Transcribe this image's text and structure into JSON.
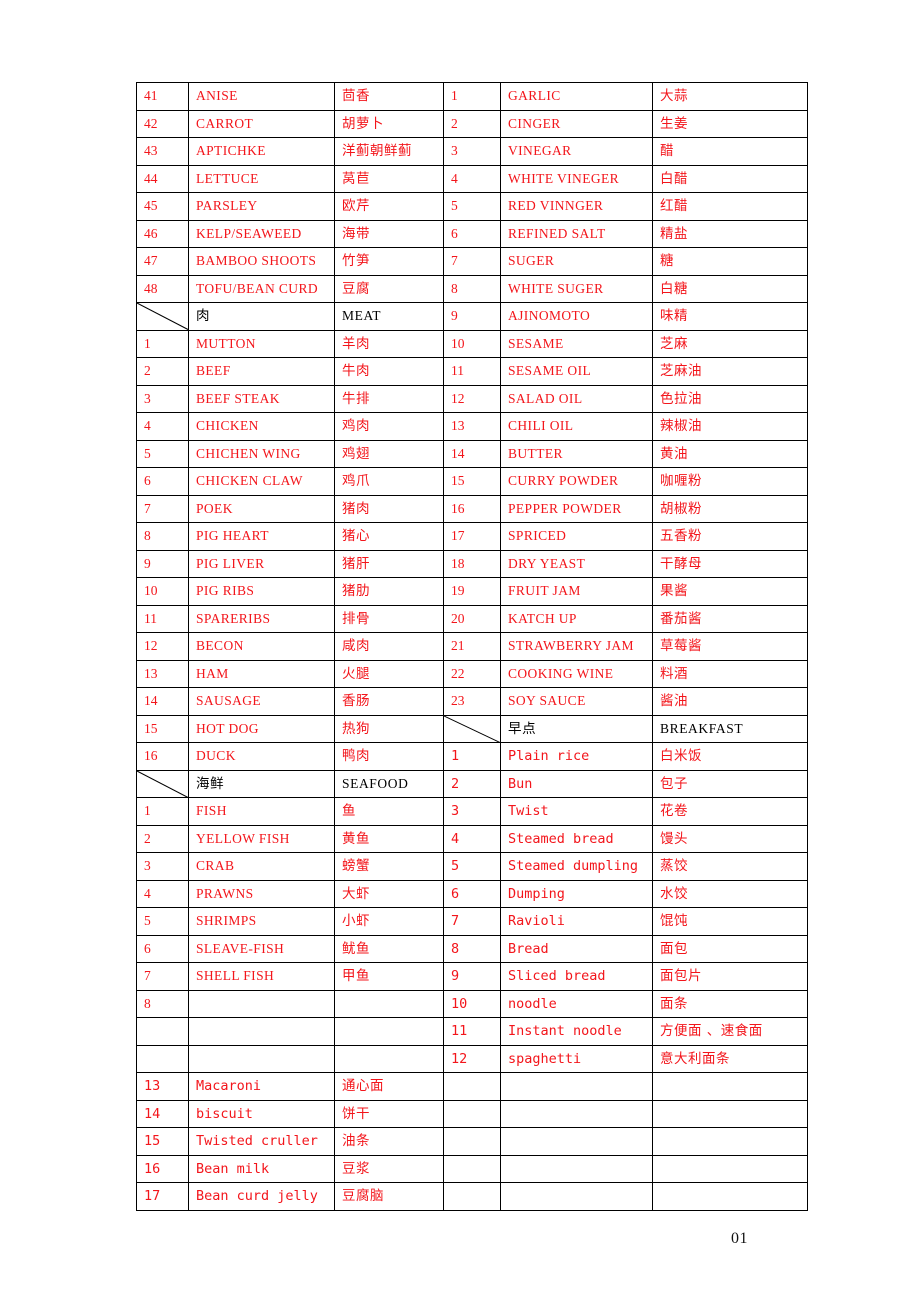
{
  "document": {
    "page_number": "01",
    "text_color": "#f3151b",
    "header_text_color": "#000000",
    "border_color": "#000000"
  },
  "table": {
    "columns": [
      "no_left",
      "english_left",
      "chinese_left",
      "no_right",
      "english_right",
      "chinese_right"
    ],
    "rows": [
      {
        "left": {
          "no": "41",
          "en": "ANISE",
          "zh": "茴香"
        },
        "right": {
          "no": "1",
          "en": "GARLIC",
          "zh": "大蒜"
        }
      },
      {
        "left": {
          "no": "42",
          "en": "CARROT",
          "zh": "胡萝卜"
        },
        "right": {
          "no": "2",
          "en": "CINGER",
          "zh": "生姜"
        }
      },
      {
        "left": {
          "no": "43",
          "en": "APTICHKE",
          "zh": "洋蓟朝鲜蓟"
        },
        "right": {
          "no": "3",
          "en": "VINEGAR",
          "zh": "醋"
        }
      },
      {
        "left": {
          "no": "44",
          "en": "LETTUCE",
          "zh": "莴苣"
        },
        "right": {
          "no": "4",
          "en": "WHITE VINEGER",
          "zh": "白醋"
        }
      },
      {
        "left": {
          "no": "45",
          "en": "PARSLEY",
          "zh": "欧芹"
        },
        "right": {
          "no": "5",
          "en": "RED VINNGER",
          "zh": "红醋"
        }
      },
      {
        "left": {
          "no": "46",
          "en": "KELP/SEAWEED",
          "zh": "海带"
        },
        "right": {
          "no": "6",
          "en": "REFINED SALT",
          "zh": "精盐"
        }
      },
      {
        "left": {
          "no": "47",
          "en": "BAMBOO SHOOTS",
          "zh": "竹笋"
        },
        "right": {
          "no": "7",
          "en": "SUGER",
          "zh": "糖"
        }
      },
      {
        "left": {
          "no": "48",
          "en": "TOFU/BEAN CURD",
          "zh": "豆腐"
        },
        "right": {
          "no": "8",
          "en": "WHITE SUGER",
          "zh": "白糖"
        }
      },
      {
        "left": {
          "no": "",
          "en": "肉",
          "zh": "MEAT",
          "style": "section"
        },
        "right": {
          "no": "9",
          "en": "AJINOMOTO",
          "zh": "味精"
        }
      },
      {
        "left": {
          "no": "1",
          "en": "MUTTON",
          "zh": "羊肉"
        },
        "right": {
          "no": "10",
          "en": "SESAME",
          "zh": "芝麻"
        }
      },
      {
        "left": {
          "no": "2",
          "en": "BEEF",
          "zh": "牛肉"
        },
        "right": {
          "no": "11",
          "en": "SESAME OIL",
          "zh": "芝麻油"
        }
      },
      {
        "left": {
          "no": "3",
          "en": "BEEF STEAK",
          "zh": "牛排"
        },
        "right": {
          "no": "12",
          "en": "SALAD OIL",
          "zh": "色拉油"
        }
      },
      {
        "left": {
          "no": "4",
          "en": "CHICKEN",
          "zh": "鸡肉"
        },
        "right": {
          "no": "13",
          "en": "CHILI OIL",
          "zh": "辣椒油"
        }
      },
      {
        "left": {
          "no": "5",
          "en": "CHICHEN WING",
          "zh": "鸡翅"
        },
        "right": {
          "no": "14",
          "en": "BUTTER",
          "zh": "黄油"
        }
      },
      {
        "left": {
          "no": "6",
          "en": "CHICKEN CLAW",
          "zh": "鸡爪"
        },
        "right": {
          "no": "15",
          "en": "CURRY POWDER",
          "zh": "咖喱粉"
        }
      },
      {
        "left": {
          "no": "7",
          "en": "POEK",
          "zh": "猪肉"
        },
        "right": {
          "no": "16",
          "en": "PEPPER POWDER",
          "zh": "胡椒粉"
        }
      },
      {
        "left": {
          "no": "8",
          "en": "PIG HEART",
          "zh": "猪心"
        },
        "right": {
          "no": "17",
          "en": "SPRICED",
          "zh": "五香粉"
        }
      },
      {
        "left": {
          "no": "9",
          "en": "PIG LIVER",
          "zh": "猪肝"
        },
        "right": {
          "no": "18",
          "en": "DRY YEAST",
          "zh": "干酵母"
        }
      },
      {
        "left": {
          "no": "10",
          "en": "PIG RIBS",
          "zh": "猪肋"
        },
        "right": {
          "no": "19",
          "en": "FRUIT JAM",
          "zh": "果酱"
        }
      },
      {
        "left": {
          "no": "11",
          "en": "SPARERIBS",
          "zh": "排骨"
        },
        "right": {
          "no": "20",
          "en": "KATCH UP",
          "zh": "番茄酱"
        }
      },
      {
        "left": {
          "no": "12",
          "en": "BECON",
          "zh": "咸肉"
        },
        "right": {
          "no": "21",
          "en": "STRAWBERRY JAM",
          "zh": "草莓酱"
        }
      },
      {
        "left": {
          "no": "13",
          "en": "HAM",
          "zh": "火腿"
        },
        "right": {
          "no": "22",
          "en": "COOKING WINE",
          "zh": "料酒"
        }
      },
      {
        "left": {
          "no": "14",
          "en": "SAUSAGE",
          "zh": "香肠"
        },
        "right": {
          "no": "23",
          "en": "SOY SAUCE",
          "zh": "酱油"
        }
      },
      {
        "left": {
          "no": "15",
          "en": "HOT DOG",
          "zh": "热狗"
        },
        "right": {
          "no": "",
          "en": "早点",
          "zh": "BREAKFAST",
          "style": "section"
        }
      },
      {
        "left": {
          "no": "16",
          "en": "DUCK",
          "zh": "鸭肉"
        },
        "right": {
          "no": "1",
          "en": "Plain  rice",
          "zh": "白米饭",
          "style": "mono"
        }
      },
      {
        "left": {
          "no": "",
          "en": "海鲜",
          "zh": "SEAFOOD",
          "style": "section"
        },
        "right": {
          "no": "2",
          "en": "Bun",
          "zh": "包子",
          "style": "mono"
        }
      },
      {
        "left": {
          "no": "1",
          "en": "FISH",
          "zh": "鱼"
        },
        "right": {
          "no": "3",
          "en": "Twist",
          "zh": "花卷",
          "style": "mono"
        }
      },
      {
        "left": {
          "no": "2",
          "en": "YELLOW FISH",
          "zh": "黄鱼"
        },
        "right": {
          "no": "4",
          "en": "Steamed bread",
          "zh": "馒头",
          "style": "mono"
        }
      },
      {
        "left": {
          "no": "3",
          "en": "CRAB",
          "zh": "螃蟹"
        },
        "right": {
          "no": "5",
          "en": "Steamed dumpling",
          "zh": "蒸饺",
          "style": "mono"
        }
      },
      {
        "left": {
          "no": "4",
          "en": "PRAWNS",
          "zh": "大虾"
        },
        "right": {
          "no": "6",
          "en": "Dumping",
          "zh": "水饺",
          "style": "mono"
        }
      },
      {
        "left": {
          "no": "5",
          "en": "SHRIMPS",
          "zh": "小虾"
        },
        "right": {
          "no": "7",
          "en": "Ravioli",
          "zh": "馄饨",
          "style": "mono"
        }
      },
      {
        "left": {
          "no": "6",
          "en": "SLEAVE-FISH",
          "zh": "鱿鱼"
        },
        "right": {
          "no": "8",
          "en": "Bread",
          "zh": "面包",
          "style": "mono"
        }
      },
      {
        "left": {
          "no": "7",
          "en": "SHELL FISH",
          "zh": "甲鱼"
        },
        "right": {
          "no": "9",
          "en": "Sliced bread",
          "zh": "面包片",
          "style": "mono"
        }
      },
      {
        "left": {
          "no": "8",
          "en": "",
          "zh": ""
        },
        "right": {
          "no": "10",
          "en": "noodle",
          "zh": "面条",
          "style": "mono"
        }
      },
      {
        "left": {
          "no": "",
          "en": "",
          "zh": ""
        },
        "right": {
          "no": "11",
          "en": "Instant noodle",
          "zh": "方便面 、速食面",
          "style": "mono"
        }
      },
      {
        "left": {
          "no": "",
          "en": "",
          "zh": ""
        },
        "right": {
          "no": "12",
          "en": "spaghetti",
          "zh": "意大利面条",
          "style": "mono"
        }
      },
      {
        "left": {
          "no": "13",
          "en": "Macaroni",
          "zh": "通心面",
          "style": "mono"
        },
        "right": {
          "no": "",
          "en": "",
          "zh": ""
        }
      },
      {
        "left": {
          "no": "14",
          "en": "biscuit",
          "zh": "饼干",
          "style": "mono"
        },
        "right": {
          "no": "",
          "en": "",
          "zh": ""
        }
      },
      {
        "left": {
          "no": "15",
          "en": "Twisted cruller",
          "zh": "油条",
          "style": "mono"
        },
        "right": {
          "no": "",
          "en": "",
          "zh": ""
        }
      },
      {
        "left": {
          "no": "16",
          "en": "Bean milk",
          "zh": "豆浆",
          "style": "mono"
        },
        "right": {
          "no": "",
          "en": "",
          "zh": ""
        }
      },
      {
        "left": {
          "no": "17",
          "en": "Bean curd jelly",
          "zh": "豆腐脑",
          "style": "mono"
        },
        "right": {
          "no": "",
          "en": "",
          "zh": ""
        }
      }
    ]
  }
}
